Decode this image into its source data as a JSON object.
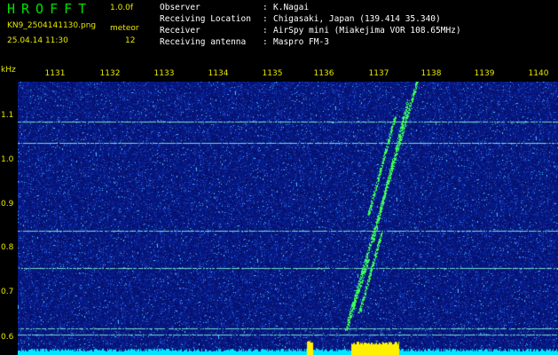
{
  "header": {
    "app_title": "HROFFT",
    "version": "1.0.0f",
    "filename": "KN9_2504141130.png",
    "datetime": "25.04.14 11:30",
    "mode_label": "meteor",
    "mode_value": "12"
  },
  "info": [
    {
      "key": "Observer",
      "sep": ":",
      "value": "K.Nagai"
    },
    {
      "key": "Receiving Location",
      "sep": ":",
      "value": "Chigasaki, Japan (139.414 35.340)"
    },
    {
      "key": "Receiver",
      "sep": ":",
      "value": "AirSpy mini (Miakejima VOR 108.65MHz)"
    },
    {
      "key": "Receiving antenna",
      "sep": ":",
      "value": "Maspro FM-3"
    }
  ],
  "axis": {
    "unit": "kHz",
    "freq_ticks": [
      "1131",
      "1132",
      "1133",
      "1134",
      "1135",
      "1136",
      "1137",
      "1138",
      "1139",
      "1140"
    ],
    "y_ticks": [
      "1.1",
      "1.0",
      "0.9",
      "0.8",
      "0.7",
      "0.6"
    ]
  },
  "colors": {
    "background": "#000000",
    "spectrogram_base": "#0a0f6e",
    "signal": "#3cff5a",
    "text_yellow": "#e8e800",
    "text_white": "#ffffff",
    "title_green": "#00e000",
    "baseline": "#00e8ff"
  }
}
